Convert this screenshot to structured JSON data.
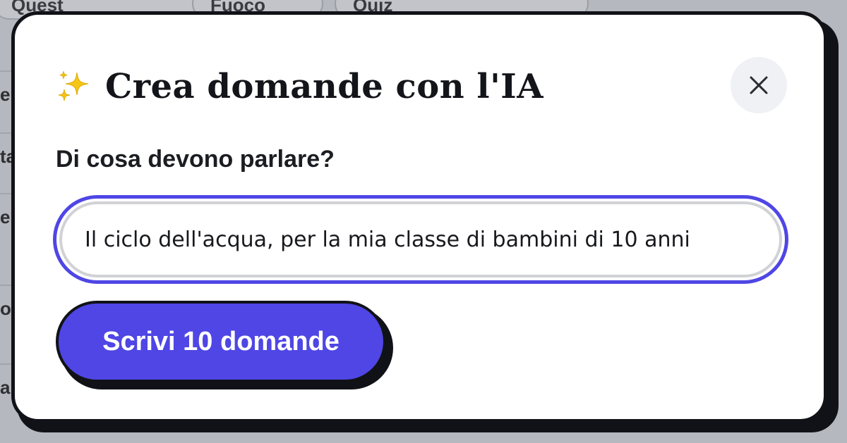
{
  "background": {
    "tabs": [
      {
        "label": "Quest"
      },
      {
        "label": "Fuoco"
      },
      {
        "label": "Quiz"
      }
    ],
    "rows": [
      {
        "label": "er"
      },
      {
        "label": "ta"
      },
      {
        "label": "er"
      },
      {
        "label": "or"
      },
      {
        "label": "a"
      }
    ]
  },
  "modal": {
    "title": "Crea domande con l'IA",
    "close_icon": "close-icon",
    "field_label": "Di cosa devono parlare?",
    "input_value": "Il ciclo dell'acqua, per la mia classe di bambini di 10 anni",
    "submit_label": "Scrivi 10 domande"
  },
  "colors": {
    "accent": "#4f46e5",
    "ink": "#111217",
    "sparkle": "#f5c518"
  }
}
